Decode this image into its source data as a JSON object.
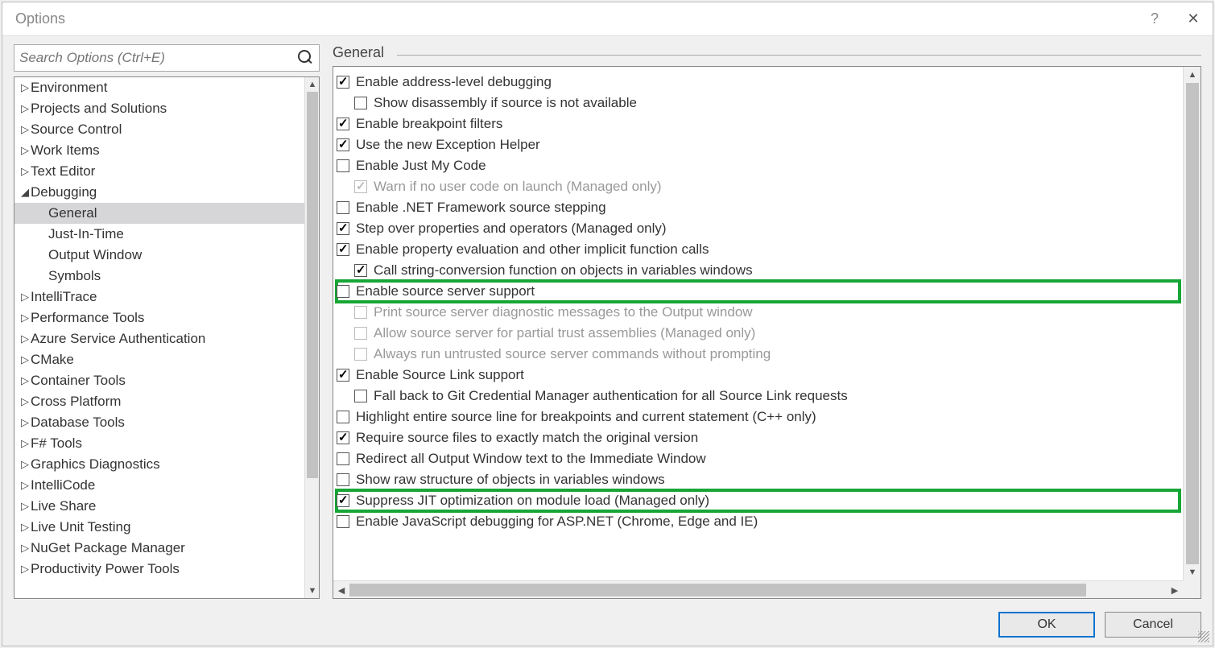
{
  "window": {
    "title": "Options"
  },
  "search": {
    "placeholder": "Search Options (Ctrl+E)"
  },
  "tree": [
    {
      "label": "Environment",
      "level": 0,
      "expandable": true,
      "open": false
    },
    {
      "label": "Projects and Solutions",
      "level": 0,
      "expandable": true,
      "open": false
    },
    {
      "label": "Source Control",
      "level": 0,
      "expandable": true,
      "open": false
    },
    {
      "label": "Work Items",
      "level": 0,
      "expandable": true,
      "open": false
    },
    {
      "label": "Text Editor",
      "level": 0,
      "expandable": true,
      "open": false
    },
    {
      "label": "Debugging",
      "level": 0,
      "expandable": true,
      "open": true
    },
    {
      "label": "General",
      "level": 1,
      "expandable": false,
      "selected": true
    },
    {
      "label": "Just-In-Time",
      "level": 1,
      "expandable": false
    },
    {
      "label": "Output Window",
      "level": 1,
      "expandable": false
    },
    {
      "label": "Symbols",
      "level": 1,
      "expandable": false
    },
    {
      "label": "IntelliTrace",
      "level": 0,
      "expandable": true,
      "open": false
    },
    {
      "label": "Performance Tools",
      "level": 0,
      "expandable": true,
      "open": false
    },
    {
      "label": "Azure Service Authentication",
      "level": 0,
      "expandable": true,
      "open": false
    },
    {
      "label": "CMake",
      "level": 0,
      "expandable": true,
      "open": false
    },
    {
      "label": "Container Tools",
      "level": 0,
      "expandable": true,
      "open": false
    },
    {
      "label": "Cross Platform",
      "level": 0,
      "expandable": true,
      "open": false
    },
    {
      "label": "Database Tools",
      "level": 0,
      "expandable": true,
      "open": false
    },
    {
      "label": "F# Tools",
      "level": 0,
      "expandable": true,
      "open": false
    },
    {
      "label": "Graphics Diagnostics",
      "level": 0,
      "expandable": true,
      "open": false
    },
    {
      "label": "IntelliCode",
      "level": 0,
      "expandable": true,
      "open": false
    },
    {
      "label": "Live Share",
      "level": 0,
      "expandable": true,
      "open": false
    },
    {
      "label": "Live Unit Testing",
      "level": 0,
      "expandable": true,
      "open": false
    },
    {
      "label": "NuGet Package Manager",
      "level": 0,
      "expandable": true,
      "open": false
    },
    {
      "label": "Productivity Power Tools",
      "level": 0,
      "expandable": true,
      "open": false
    }
  ],
  "section": {
    "title": "General"
  },
  "options": [
    {
      "label": "Enable address-level debugging",
      "checked": true,
      "indent": 0
    },
    {
      "label": "Show disassembly if source is not available",
      "checked": false,
      "indent": 1
    },
    {
      "label": "Enable breakpoint filters",
      "checked": true,
      "indent": 0
    },
    {
      "label": "Use the new Exception Helper",
      "checked": true,
      "indent": 0
    },
    {
      "label": "Enable Just My Code",
      "checked": false,
      "indent": 0
    },
    {
      "label": "Warn if no user code on launch (Managed only)",
      "checked": true,
      "indent": 1,
      "disabled": true
    },
    {
      "label": "Enable .NET Framework source stepping",
      "checked": false,
      "indent": 0
    },
    {
      "label": "Step over properties and operators (Managed only)",
      "checked": true,
      "indent": 0
    },
    {
      "label": "Enable property evaluation and other implicit function calls",
      "checked": true,
      "indent": 0
    },
    {
      "label": "Call string-conversion function on objects in variables windows",
      "checked": true,
      "indent": 1
    },
    {
      "label": "Enable source server support",
      "checked": false,
      "indent": 0,
      "highlight": 1
    },
    {
      "label": "Print source server diagnostic messages to the Output window",
      "checked": false,
      "indent": 1,
      "disabled": true
    },
    {
      "label": "Allow source server for partial trust assemblies (Managed only)",
      "checked": false,
      "indent": 1,
      "disabled": true
    },
    {
      "label": "Always run untrusted source server commands without prompting",
      "checked": false,
      "indent": 1,
      "disabled": true
    },
    {
      "label": "Enable Source Link support",
      "checked": true,
      "indent": 0
    },
    {
      "label": "Fall back to Git Credential Manager authentication for all Source Link requests",
      "checked": false,
      "indent": 1
    },
    {
      "label": "Highlight entire source line for breakpoints and current statement (C++ only)",
      "checked": false,
      "indent": 0
    },
    {
      "label": "Require source files to exactly match the original version",
      "checked": true,
      "indent": 0
    },
    {
      "label": "Redirect all Output Window text to the Immediate Window",
      "checked": false,
      "indent": 0
    },
    {
      "label": "Show raw structure of objects in variables windows",
      "checked": false,
      "indent": 0
    },
    {
      "label": "Suppress JIT optimization on module load (Managed only)",
      "checked": true,
      "indent": 0,
      "highlight": 2
    },
    {
      "label": "Enable JavaScript debugging for ASP.NET (Chrome, Edge and IE)",
      "checked": false,
      "indent": 0
    }
  ],
  "buttons": {
    "ok": "OK",
    "cancel": "Cancel"
  }
}
